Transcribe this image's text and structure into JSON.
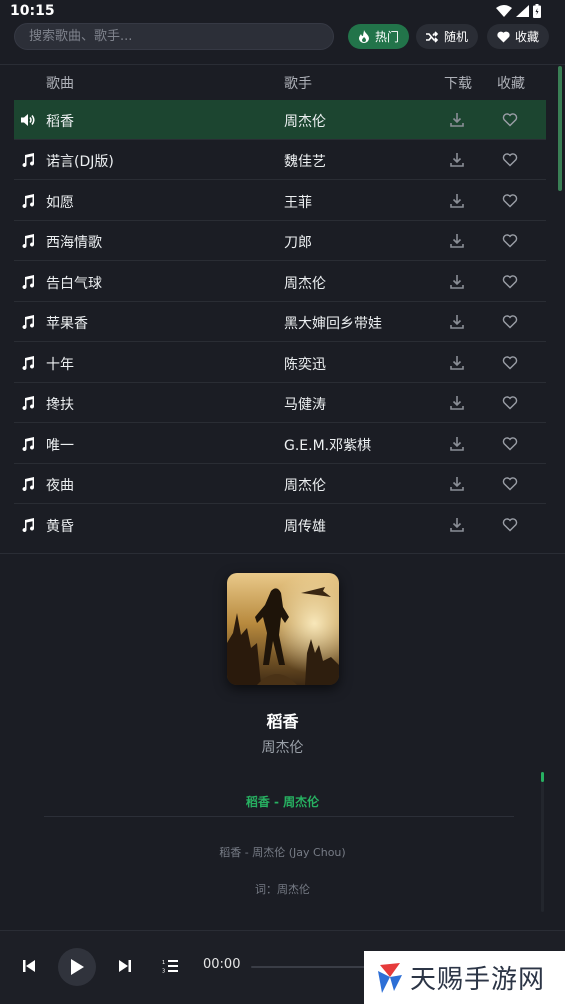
{
  "status_bar": {
    "time": "10:15"
  },
  "search": {
    "placeholder": "搜索歌曲、歌手..."
  },
  "filters": {
    "hot": "热门",
    "random": "随机",
    "favorites": "收藏"
  },
  "table": {
    "headers": {
      "song": "歌曲",
      "artist": "歌手",
      "download": "下载",
      "favorite": "收藏"
    },
    "rows": [
      {
        "name": "稻香",
        "artist": "周杰伦",
        "playing": true
      },
      {
        "name": "诺言(DJ版)",
        "artist": "魏佳艺",
        "playing": false
      },
      {
        "name": "如愿",
        "artist": "王菲",
        "playing": false
      },
      {
        "name": "西海情歌",
        "artist": "刀郎",
        "playing": false
      },
      {
        "name": "告白气球",
        "artist": "周杰伦",
        "playing": false
      },
      {
        "name": "苹果香",
        "artist": "黑大婶回乡带娃",
        "playing": false
      },
      {
        "name": "十年",
        "artist": "陈奕迅",
        "playing": false
      },
      {
        "name": "搀扶",
        "artist": "马健涛",
        "playing": false
      },
      {
        "name": "唯一",
        "artist": "G.E.M.邓紫棋",
        "playing": false
      },
      {
        "name": "夜曲",
        "artist": "周杰伦",
        "playing": false
      },
      {
        "name": "黄昏",
        "artist": "周传雄",
        "playing": false
      }
    ]
  },
  "now_playing": {
    "title": "稻香",
    "artist": "周杰伦",
    "lyric_current": "稻香 - 周杰伦",
    "lyric_lines": [
      "稻香 - 周杰伦 (Jay Chou)",
      "词：周杰伦"
    ]
  },
  "player": {
    "current_time": "00:00",
    "progress": 0
  },
  "watermark": {
    "text": "天赐手游网"
  },
  "colors": {
    "accent": "#27b061",
    "active_row": "#1c4530",
    "background": "#1b1d24"
  },
  "icons": [
    "speaker-icon",
    "music-note-icon",
    "download-icon",
    "heart-icon",
    "fire-icon",
    "shuffle-icon",
    "prev-icon",
    "play-icon",
    "next-icon",
    "playlist-icon"
  ]
}
